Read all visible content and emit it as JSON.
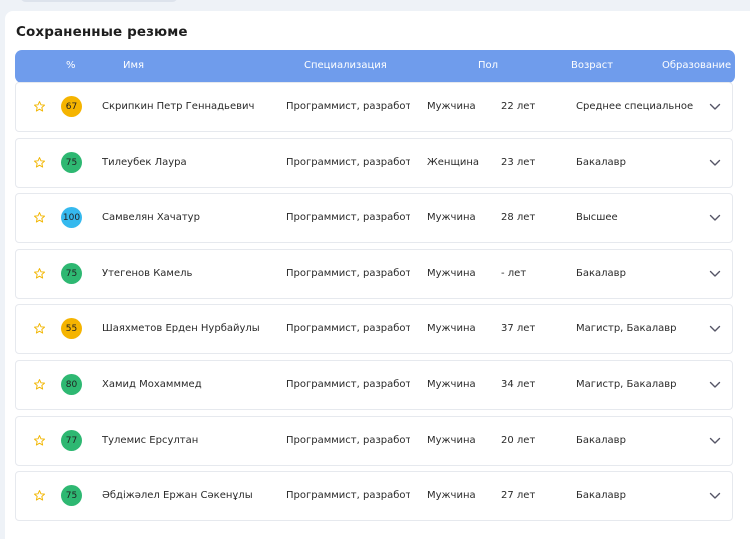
{
  "page": {
    "title": "Сохраненные резюме"
  },
  "table": {
    "headers": {
      "percent": "%",
      "name": "Имя",
      "specialization": "Специализация",
      "gender": "Пол",
      "age": "Возраст",
      "education": "Образование"
    },
    "rows": [
      {
        "score": "67",
        "score_color": "#f5b400",
        "name": "Скрипкин Петр Геннадьевич",
        "specialization": "Программист, разработчик",
        "gender": "Мужчина",
        "age": "22 лет",
        "education": "Среднее специальное"
      },
      {
        "score": "75",
        "score_color": "#2eb872",
        "name": "Тилеубек Лаура",
        "specialization": "Программист, разработчик",
        "gender": "Женщина",
        "age": "23 лет",
        "education": "Бакалавр"
      },
      {
        "score": "100",
        "score_color": "#35b9ee",
        "name": "Самвелян Хачатур",
        "specialization": "Программист, разработчик",
        "gender": "Мужчина",
        "age": "28 лет",
        "education": "Высшее"
      },
      {
        "score": "75",
        "score_color": "#2eb872",
        "name": "Утегенов Камель",
        "specialization": "Программист, разработчик",
        "gender": "Мужчина",
        "age": "- лет",
        "education": "Бакалавр"
      },
      {
        "score": "55",
        "score_color": "#f5b400",
        "name": "Шаяхметов Ерден Нурбайулы",
        "specialization": "Программист, разработчик",
        "gender": "Мужчина",
        "age": "37 лет",
        "education": "Магистр, Бакалавр"
      },
      {
        "score": "80",
        "score_color": "#2eb872",
        "name": "Хамид Мохамммед",
        "specialization": "Программист, разработчик",
        "gender": "Мужчина",
        "age": "34 лет",
        "education": "Магистр, Бакалавр"
      },
      {
        "score": "77",
        "score_color": "#2eb872",
        "name": "Тулемис Ерсултан",
        "specialization": "Программист, разработчик",
        "gender": "Мужчина",
        "age": "20 лет",
        "education": "Бакалавр"
      },
      {
        "score": "75",
        "score_color": "#2eb872",
        "name": "Әбдіжәлел Ержан Сәкенұлы",
        "specialization": "Программист, разработчик",
        "gender": "Мужчина",
        "age": "27 лет",
        "education": "Бакалавр"
      }
    ]
  },
  "icons": {
    "favorite": "star-icon",
    "expand": "chevron-down-icon"
  },
  "colors": {
    "header_bg": "#6f9cec",
    "star": "#f2b705"
  }
}
